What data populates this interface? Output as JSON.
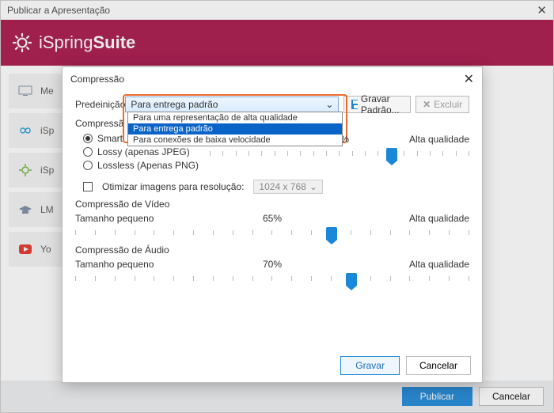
{
  "window": {
    "title": "Publicar a Apresentação"
  },
  "brand": {
    "name1": "iSpring ",
    "name2": "Suite"
  },
  "sidebar": {
    "items": [
      {
        "label": "Me"
      },
      {
        "label": "iSp"
      },
      {
        "label": "iSp"
      },
      {
        "label": "LM"
      },
      {
        "label": "Yo"
      }
    ]
  },
  "footer": {
    "publish": "Publicar",
    "cancel": "Cancelar"
  },
  "modal": {
    "title": "Compressão",
    "preset_label": "Predeinição",
    "preset_selected": "Para entrega padrão",
    "preset_options": [
      "Para uma representação de alta qualidade",
      "Para entrega padrão",
      "Para conexões de baixa velocidade"
    ],
    "save_default": "Gravar Padrão...",
    "delete": "Excluir",
    "img_section": "Compressã",
    "radios": {
      "smart": "Smart",
      "lossy": "Lossy (apenas JPEG)",
      "lossless": "Lossless (Apenas PNG)"
    },
    "optimize": "Otimizar imagens para resolução:",
    "resolution": "1024 x 768",
    "small": "Tamanho pequeno",
    "high": "Alta qualidade",
    "img_pct": "70%",
    "video_section": "Compressão de Vídeo",
    "video_pct": "65%",
    "audio_section": "Compressão de Áudio",
    "audio_pct": "70%",
    "save": "Gravar",
    "cancel": "Cancelar"
  },
  "sliders": {
    "img": 70,
    "video": 65,
    "audio": 70
  }
}
